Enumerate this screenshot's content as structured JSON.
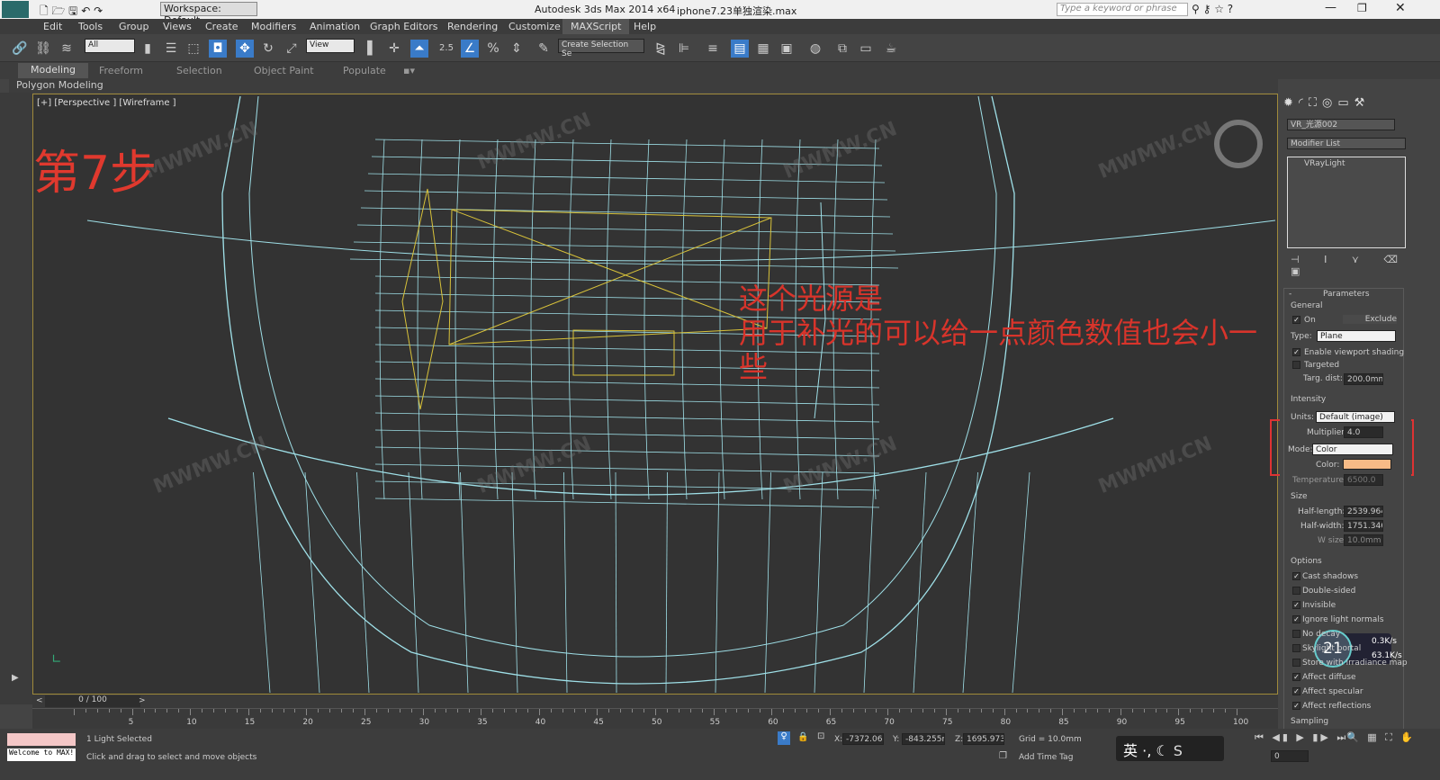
{
  "window": {
    "title": "Autodesk 3ds Max  2014 x64",
    "file": "iphone7.23单独渲染.max",
    "workspace": "Workspace: Default",
    "search_placeholder": "Type a keyword or phrase"
  },
  "menu": [
    "Edit",
    "Tools",
    "Group",
    "Views",
    "Create",
    "Modifiers",
    "Animation",
    "Graph Editors",
    "Rendering",
    "Customize",
    "MAXScript",
    "Help"
  ],
  "toolbar": {
    "filter": "All",
    "coord": "View",
    "selection_set": "Create Selection Se",
    "snap_angle": "2.5"
  },
  "ribbon": {
    "tabs": [
      "Modeling",
      "Freeform",
      "Selection",
      "Object Paint",
      "Populate"
    ],
    "sub": "Polygon Modeling"
  },
  "viewport": {
    "label": "[+] [Perspective ] [Wireframe ]",
    "step": "第7步",
    "note_line1": "这个光源是",
    "note_line2": "用于补光的可以给一点颜色数值也会小一些",
    "watermark": "MWMW.CN"
  },
  "panel": {
    "object_name": "VR_光源002",
    "modifier_list": "Modifier List",
    "stack_item": "VRayLight",
    "rollout": "Parameters",
    "general": "General",
    "on": "On",
    "exclude": "Exclude",
    "type_label": "Type:",
    "type": "Plane",
    "enable_viewport_shading": "Enable viewport shading",
    "targeted": "Targeted",
    "targ_dist_label": "Targ. dist:",
    "targ_dist": "200.0mm",
    "intensity": "Intensity",
    "units_label": "Units:",
    "units": "Default (image)",
    "multiplier_label": "Multiplier:",
    "multiplier": "4.0",
    "mode_label": "Mode:",
    "mode": "Color",
    "color_label": "Color:",
    "color": "#f7bb87",
    "temperature_label": "Temperature:",
    "temperature": "6500.0",
    "size": "Size",
    "half_length_label": "Half-length:",
    "half_length": "2539.964",
    "half_width_label": "Half-width:",
    "half_width": "1751.346",
    "wsize_label": "W size",
    "wsize": "10.0mm",
    "options": "Options",
    "sampling": "Sampling",
    "option_items": [
      {
        "label": "Cast shadows",
        "checked": true
      },
      {
        "label": "Double-sided",
        "checked": false
      },
      {
        "label": "Invisible",
        "checked": true
      },
      {
        "label": "Ignore light normals",
        "checked": true
      },
      {
        "label": "No decay",
        "checked": false
      },
      {
        "label": "Skylight portal",
        "checked": false
      },
      {
        "label": "Store with irradiance map",
        "checked": false
      },
      {
        "label": "Affect diffuse",
        "checked": true
      },
      {
        "label": "Affect specular",
        "checked": true
      },
      {
        "label": "Affect reflections",
        "checked": true
      }
    ]
  },
  "net_widget": {
    "percent": "21",
    "up": "0.3K/s",
    "down": "63.1K/s"
  },
  "timeline": {
    "frame": "0 / 100",
    "ticks": [
      "5",
      "10",
      "15",
      "20",
      "25",
      "30",
      "35",
      "40",
      "45",
      "50",
      "55",
      "60",
      "65",
      "70",
      "75",
      "80",
      "85",
      "90",
      "95",
      "100"
    ]
  },
  "status": {
    "selected": "1 Light Selected",
    "prompt": "Click and drag to select and move objects",
    "x_label": "X:",
    "x": "-7372.061",
    "y_label": "Y:",
    "y": "-843.255m",
    "z_label": "Z:",
    "z": "1695.973r",
    "grid": "Grid = 10.0mm",
    "add_time_tag": "Add Time Tag",
    "maxscript": "Welcome to MAX!",
    "frame_input": "0",
    "ime": "英"
  },
  "colors": {
    "wire": "#9fe0e8",
    "light": "#d8c23a",
    "annotation": "#d8342b"
  }
}
